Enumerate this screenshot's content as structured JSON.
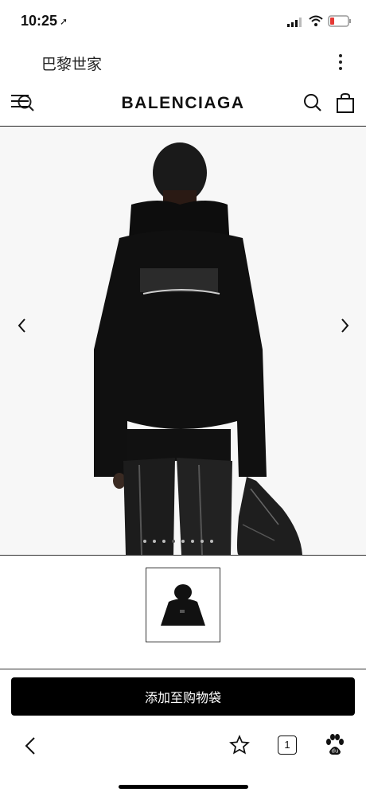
{
  "status": {
    "time": "10:25",
    "location_icon": "location-arrow-icon"
  },
  "search": {
    "query": "巴黎世家"
  },
  "header": {
    "brand": "BALENCIAGA"
  },
  "gallery": {
    "total_images": 8,
    "active_index": 3
  },
  "product": {
    "add_to_bag_label": "添加至购物袋"
  },
  "toolbar": {
    "tabs_count": "1"
  }
}
